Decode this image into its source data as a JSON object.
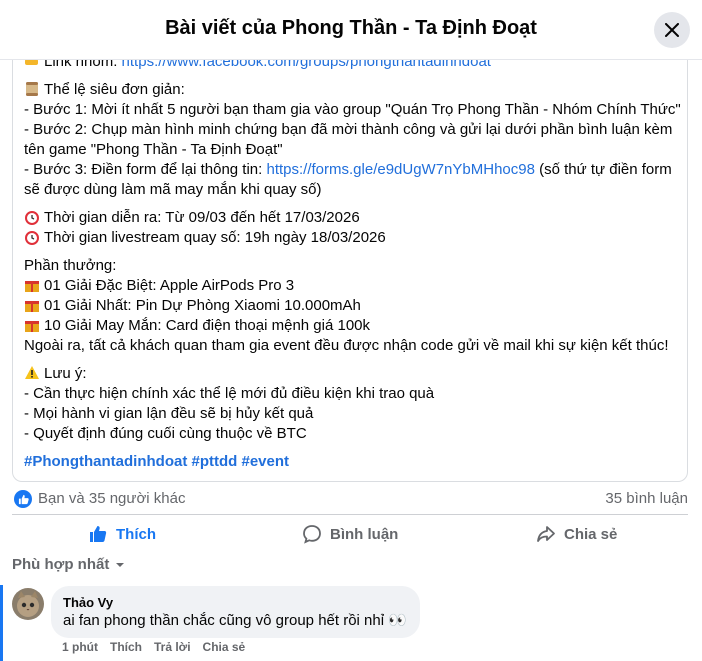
{
  "header": {
    "title": "Bài viết của Phong Thần - Ta Định Đoạt"
  },
  "post": {
    "group_link_label": "Link nhóm: ",
    "group_link_url": "https://www.facebook.com/groups/phongthantadinhdoat",
    "rules_title": "Thể lệ siêu đơn giản:",
    "step1": "- Bước 1: Mời ít nhất 5 người bạn tham gia vào group \"Quán Trọ Phong Thần - Nhóm Chính Thức\"",
    "step2": "- Bước 2: Chụp màn hình minh chứng bạn đã mời thành công và gửi lại dưới phần bình luận kèm tên game \"Phong Thần - Ta Định Đoạt\"",
    "step3_prefix": "- Bước 3: Điền form để lại thông tin: ",
    "step3_link": "https://forms.gle/e9dUgW7nYbMHhoc98",
    "step3_suffix": " (số thứ tự điền form sẽ được dùng làm mã may mắn khi quay số)",
    "time1": "Thời gian diễn ra: Từ 09/03 đến hết 17/03/2026",
    "time2": "Thời gian livestream quay số: 19h ngày 18/03/2026",
    "prizes_title": "Phần thưởng:",
    "prize1": "01 Giải Đặc Biệt: Apple AirPods Pro 3",
    "prize2": "01 Giải Nhất: Pin Dự Phòng Xiaomi 10.000mAh",
    "prize3": "10 Giải May Mắn: Card điện thoại mệnh giá 100k",
    "extra": "Ngoài ra, tất cả khách quan tham gia event đều được nhận code gửi về mail khi sự kiện kết thúc!",
    "note_title": "Lưu ý:",
    "note1": "- Cần thực hiện chính xác thể lệ mới đủ điều kiện khi trao quà",
    "note2": "- Mọi hành vi gian lận đều sẽ bị hủy kết quả",
    "note3": "- Quyết định đúng cuối cùng thuộc về BTC",
    "hashtags": "#Phongthantadinhdoat #pttdd #event"
  },
  "reactions": {
    "text": "Bạn và 35 người khác",
    "comments": "35 bình luận"
  },
  "actions": {
    "like": "Thích",
    "comment": "Bình luận",
    "share": "Chia sẻ"
  },
  "sort": {
    "label": "Phù hợp nhất"
  },
  "comment": {
    "author": "Thảo Vy",
    "text": "ai fan phong thần chắc cũng vô group hết rồi nhỉ 👀",
    "time": "1 phút",
    "like": "Thích",
    "reply": "Trả lời",
    "share": "Chia sẻ"
  },
  "icons": {
    "pointer": "hand-pointing-icon",
    "scroll": "scroll-icon",
    "clock": "alarm-clock-icon",
    "gift": "gift-icon",
    "warning": "warning-icon",
    "close": "close-icon",
    "like": "thumbs-up-icon",
    "comment": "speech-bubble-icon",
    "share": "share-arrow-icon"
  },
  "colors": {
    "link": "#216fdb",
    "accent": "#1877f2",
    "muted": "#65676b"
  }
}
